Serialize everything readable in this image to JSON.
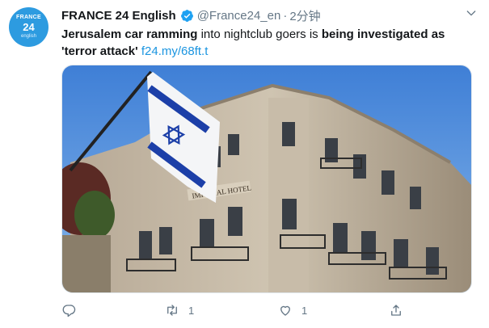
{
  "tweet": {
    "avatar": {
      "line1": "FRANCE",
      "line2": "24",
      "line3": "english",
      "color": "#2d9be0"
    },
    "author_name": "FRANCE 24 English",
    "handle": "@France24_en",
    "separator": "·",
    "time": "2分钟",
    "text_parts": {
      "p1": "Jerusalem car ramming",
      "p2": " into nightclub goers is ",
      "p3": "being investigated as",
      "p4": "'terror attack'",
      "p5": " ",
      "link": "f24.my/68ft.t"
    },
    "image": {
      "sign_text": "IMPERIAL HOTEL",
      "description_icon": "building-photo"
    },
    "actions": {
      "reply_count": "",
      "retweet_count": "1",
      "like_count": "1",
      "share_count": ""
    },
    "colors": {
      "link": "#1b95e0",
      "verified": "#1da1f2",
      "muted": "#657786"
    }
  }
}
